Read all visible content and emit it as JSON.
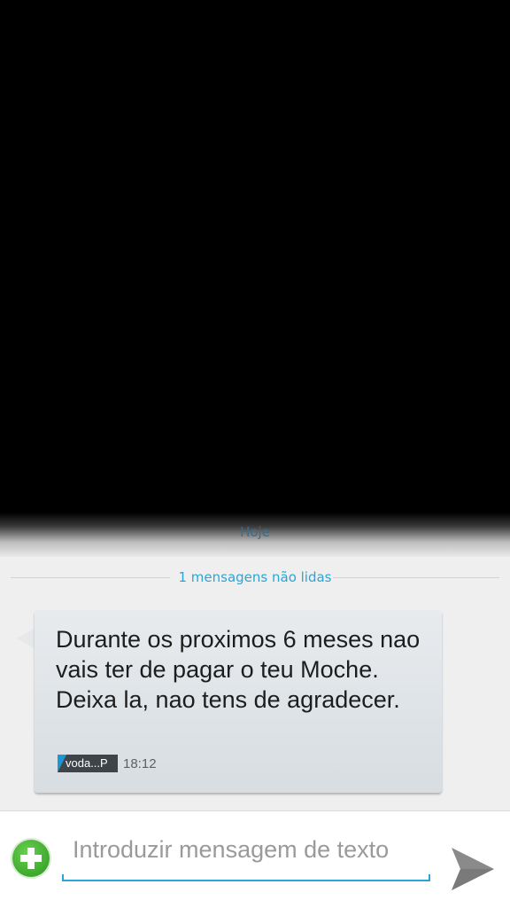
{
  "conversation": {
    "date_header": "Hoje",
    "unread_divider": "1 mensagens não lidas"
  },
  "message": {
    "body": "Durante os proximos 6 meses nao vais ter de pagar o teu Moche. Deixa la, nao tens de agradecer.",
    "sim_label": "voda...P",
    "time": "18:12"
  },
  "composer": {
    "placeholder": "Introduzir mensagem de texto",
    "attach_icon": "add-circle-icon",
    "send_icon": "send-icon"
  },
  "colors": {
    "accent": "#2aa6d5",
    "attach_green": "#3ea82f",
    "send_gray": "#8a8a8a"
  }
}
